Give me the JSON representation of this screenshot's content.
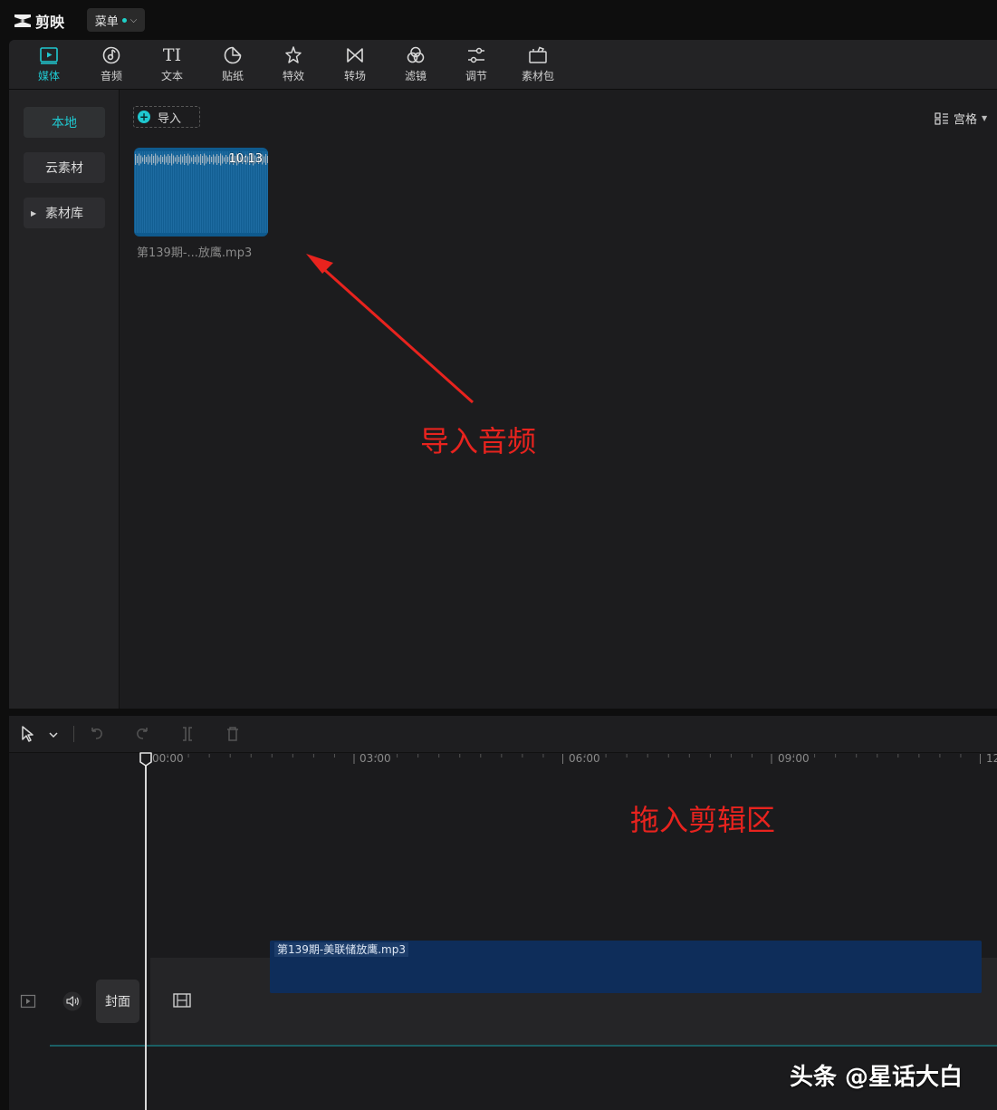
{
  "app": {
    "name": "剪映",
    "menu_label": "菜单"
  },
  "tool_tabs": [
    {
      "label": "媒体",
      "icon": "media-icon",
      "active": true
    },
    {
      "label": "音频",
      "icon": "audio-icon"
    },
    {
      "label": "文本",
      "icon": "text-icon",
      "glyph": "TI"
    },
    {
      "label": "贴纸",
      "icon": "sticker-icon"
    },
    {
      "label": "特效",
      "icon": "effects-icon"
    },
    {
      "label": "转场",
      "icon": "transition-icon"
    },
    {
      "label": "滤镜",
      "icon": "filter-icon"
    },
    {
      "label": "调节",
      "icon": "adjust-icon"
    },
    {
      "label": "素材包",
      "icon": "asset-pack-icon"
    }
  ],
  "sidebar": {
    "items": [
      {
        "label": "本地",
        "active": true
      },
      {
        "label": "云素材"
      },
      {
        "label": "素材库",
        "expandable": true
      }
    ]
  },
  "media": {
    "import_label": "导入",
    "view_label": "宫格",
    "items": [
      {
        "name": "第139期-...放鹰.mp3",
        "duration": "10:13"
      }
    ]
  },
  "annotations": {
    "import": "导入音频",
    "drag": "拖入剪辑区"
  },
  "timeline": {
    "ticks": [
      "00:00",
      "03:00",
      "06:00",
      "09:00",
      "12"
    ],
    "clip_label": "第139期-美联储放鹰.mp3",
    "cover_label": "封面"
  },
  "watermark": "头条 @星话大白",
  "colors": {
    "accent": "#1fc8d0",
    "annotation": "#e8231e",
    "clip": "#0e2d5a"
  }
}
